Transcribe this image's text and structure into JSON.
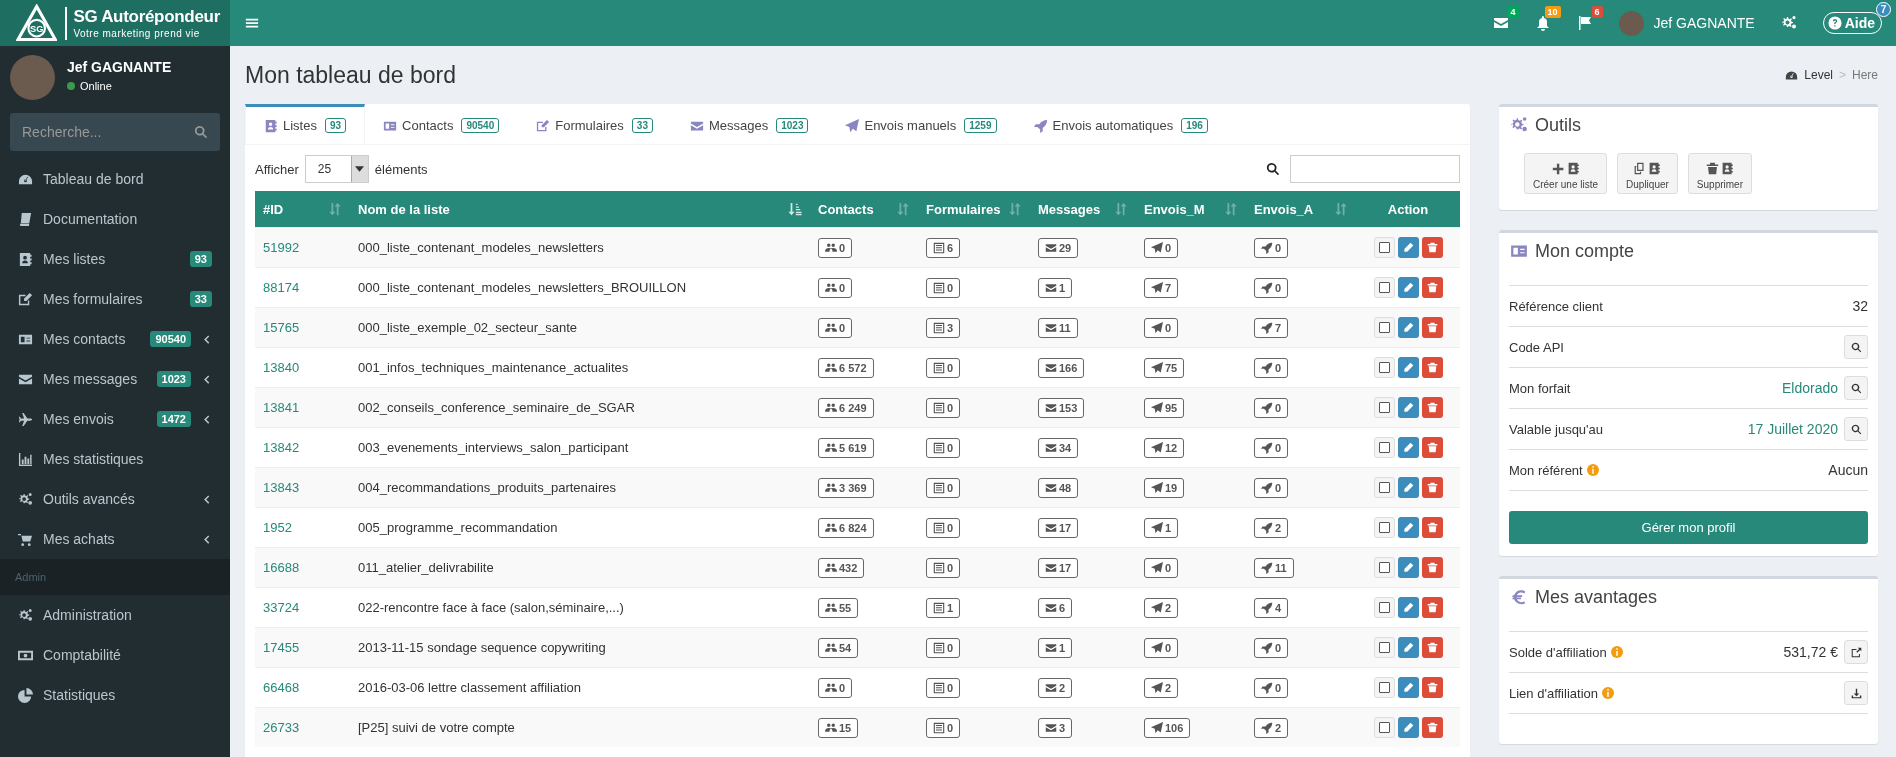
{
  "brand": {
    "logo_text": "SG",
    "name": "SG Autorépondeur",
    "tagline": "Votre marketing prend vie"
  },
  "navbar": {
    "notifications": [
      {
        "count": "4",
        "color": "#00a65a"
      },
      {
        "count": "10",
        "color": "#f39c12"
      },
      {
        "count": "6",
        "color": "#dd4b39"
      }
    ],
    "user": "Jef GAGNANTE",
    "help": {
      "label": "Aide",
      "count": "7"
    }
  },
  "sidebar": {
    "user": {
      "name": "Jef GAGNANTE",
      "status": "Online"
    },
    "search": {
      "placeholder": "Recherche..."
    },
    "items": [
      {
        "label": "Tableau de bord",
        "expandable": false
      },
      {
        "label": "Documentation",
        "expandable": false
      },
      {
        "label": "Mes listes",
        "badge": "93",
        "expandable": false
      },
      {
        "label": "Mes formulaires",
        "badge": "33",
        "expandable": false
      },
      {
        "label": "Mes contacts",
        "badge": "90540",
        "expandable": true
      },
      {
        "label": "Mes messages",
        "badge": "1023",
        "expandable": true
      },
      {
        "label": "Mes envois",
        "badge": "1472",
        "expandable": true
      },
      {
        "label": "Mes statistiques",
        "expandable": false
      },
      {
        "label": "Outils avancés",
        "expandable": true
      },
      {
        "label": "Mes achats",
        "expandable": true
      }
    ],
    "admin_header": "Admin",
    "admin_items": [
      {
        "label": "Administration",
        "expandable": false
      },
      {
        "label": "Comptabilité",
        "expandable": false
      },
      {
        "label": "Statistiques",
        "expandable": false
      }
    ]
  },
  "page": {
    "title": "Mon tableau de bord",
    "breadcrumb": [
      "Level",
      "Here"
    ],
    "breadcrumb_separator": ">"
  },
  "tabs": [
    {
      "label": "Listes",
      "count": "93",
      "selected": true
    },
    {
      "label": "Contacts",
      "count": "90540",
      "selected": false
    },
    {
      "label": "Formulaires",
      "count": "33",
      "selected": false
    },
    {
      "label": "Messages",
      "count": "1023",
      "selected": false
    },
    {
      "label": "Envois manuels",
      "count": "1259",
      "selected": false
    },
    {
      "label": "Envois automatiques",
      "count": "196",
      "selected": false
    }
  ],
  "table_controls": {
    "show_label": "Afficher",
    "page_size": "25",
    "page_size_suffix": "éléments"
  },
  "table": {
    "columns": [
      {
        "label": "#ID",
        "kind": "sortable"
      },
      {
        "label": "Nom de la liste",
        "kind": "sorted"
      },
      {
        "label": "Contacts",
        "kind": "sortable"
      },
      {
        "label": "Formulaires",
        "kind": "sortable"
      },
      {
        "label": "Messages",
        "kind": "sortable"
      },
      {
        "label": "Envois_M",
        "kind": "sortable"
      },
      {
        "label": "Envois_A",
        "kind": "sortable"
      },
      {
        "label": "Action",
        "kind": "plain"
      }
    ],
    "rows": [
      {
        "id": "51992",
        "name": "000_liste_contenant_modeles_newsletters",
        "contacts": "0",
        "forms": "6",
        "messages": "29",
        "manual": "0",
        "auto": "0",
        "checked": false
      },
      {
        "id": "88174",
        "name": "000_liste_contenant_modeles_newsletters_BROUILLON",
        "contacts": "0",
        "forms": "0",
        "messages": "1",
        "manual": "7",
        "auto": "0",
        "checked": false
      },
      {
        "id": "15765",
        "name": "000_liste_exemple_02_secteur_sante",
        "contacts": "0",
        "forms": "3",
        "messages": "11",
        "manual": "0",
        "auto": "7",
        "checked": false
      },
      {
        "id": "13840",
        "name": "001_infos_techniques_maintenance_actualites",
        "contacts": "6 572",
        "forms": "0",
        "messages": "166",
        "manual": "75",
        "auto": "0",
        "checked": false
      },
      {
        "id": "13841",
        "name": "002_conseils_conference_seminaire_de_SGAR",
        "contacts": "6 249",
        "forms": "0",
        "messages": "153",
        "manual": "95",
        "auto": "0",
        "checked": false
      },
      {
        "id": "13842",
        "name": "003_evenements_interviews_salon_participant",
        "contacts": "5 619",
        "forms": "0",
        "messages": "34",
        "manual": "12",
        "auto": "0",
        "checked": false
      },
      {
        "id": "13843",
        "name": "004_recommandations_produits_partenaires",
        "contacts": "3 369",
        "forms": "0",
        "messages": "48",
        "manual": "19",
        "auto": "0",
        "checked": false
      },
      {
        "id": "1952",
        "name": "005_programme_recommandation",
        "contacts": "6 824",
        "forms": "0",
        "messages": "17",
        "manual": "1",
        "auto": "2",
        "checked": false
      },
      {
        "id": "16688",
        "name": "011_atelier_delivrabilite",
        "contacts": "432",
        "forms": "0",
        "messages": "17",
        "manual": "0",
        "auto": "11",
        "checked": false
      },
      {
        "id": "33724",
        "name": "022-rencontre face à face (salon,séminaire,...)",
        "contacts": "55",
        "forms": "1",
        "messages": "6",
        "manual": "2",
        "auto": "4",
        "checked": false
      },
      {
        "id": "17455",
        "name": "2013-11-15 sondage sequence copywriting",
        "contacts": "54",
        "forms": "0",
        "messages": "1",
        "manual": "0",
        "auto": "0",
        "checked": false
      },
      {
        "id": "66468",
        "name": "2016-03-06 lettre classement affiliation",
        "contacts": "0",
        "forms": "0",
        "messages": "2",
        "manual": "2",
        "auto": "0",
        "checked": false
      },
      {
        "id": "26733",
        "name": "[P25] suivi de votre compte",
        "contacts": "15",
        "forms": "0",
        "messages": "3",
        "manual": "106",
        "auto": "2",
        "checked": false
      }
    ]
  },
  "tools": {
    "title": "Outils",
    "buttons": [
      "Créer une liste",
      "Dupliquer",
      "Supprimer"
    ]
  },
  "account": {
    "title": "Mon compte",
    "rows": [
      {
        "label": "Référence client",
        "value": "32",
        "kind": "plain",
        "info": false,
        "button": false
      },
      {
        "label": "Code API",
        "info": false,
        "button": true
      },
      {
        "label": "Mon forfait",
        "value": "Eldorado",
        "kind": "link",
        "info": false,
        "button": true
      },
      {
        "label": "Valable jusqu'au",
        "value": "17 Juillet 2020",
        "kind": "link",
        "info": false,
        "button": true
      },
      {
        "label": "Mon référent",
        "value": "Aucun",
        "kind": "plain",
        "info": true,
        "button": false
      }
    ],
    "button": "Gérer mon profil"
  },
  "advantages": {
    "title": "Mes avantages",
    "rows": [
      {
        "label": "Solde d'affiliation",
        "value": "531,72 €",
        "info": true,
        "button": true
      },
      {
        "label": "Lien d'affiliation",
        "info": true,
        "button": true
      }
    ]
  }
}
